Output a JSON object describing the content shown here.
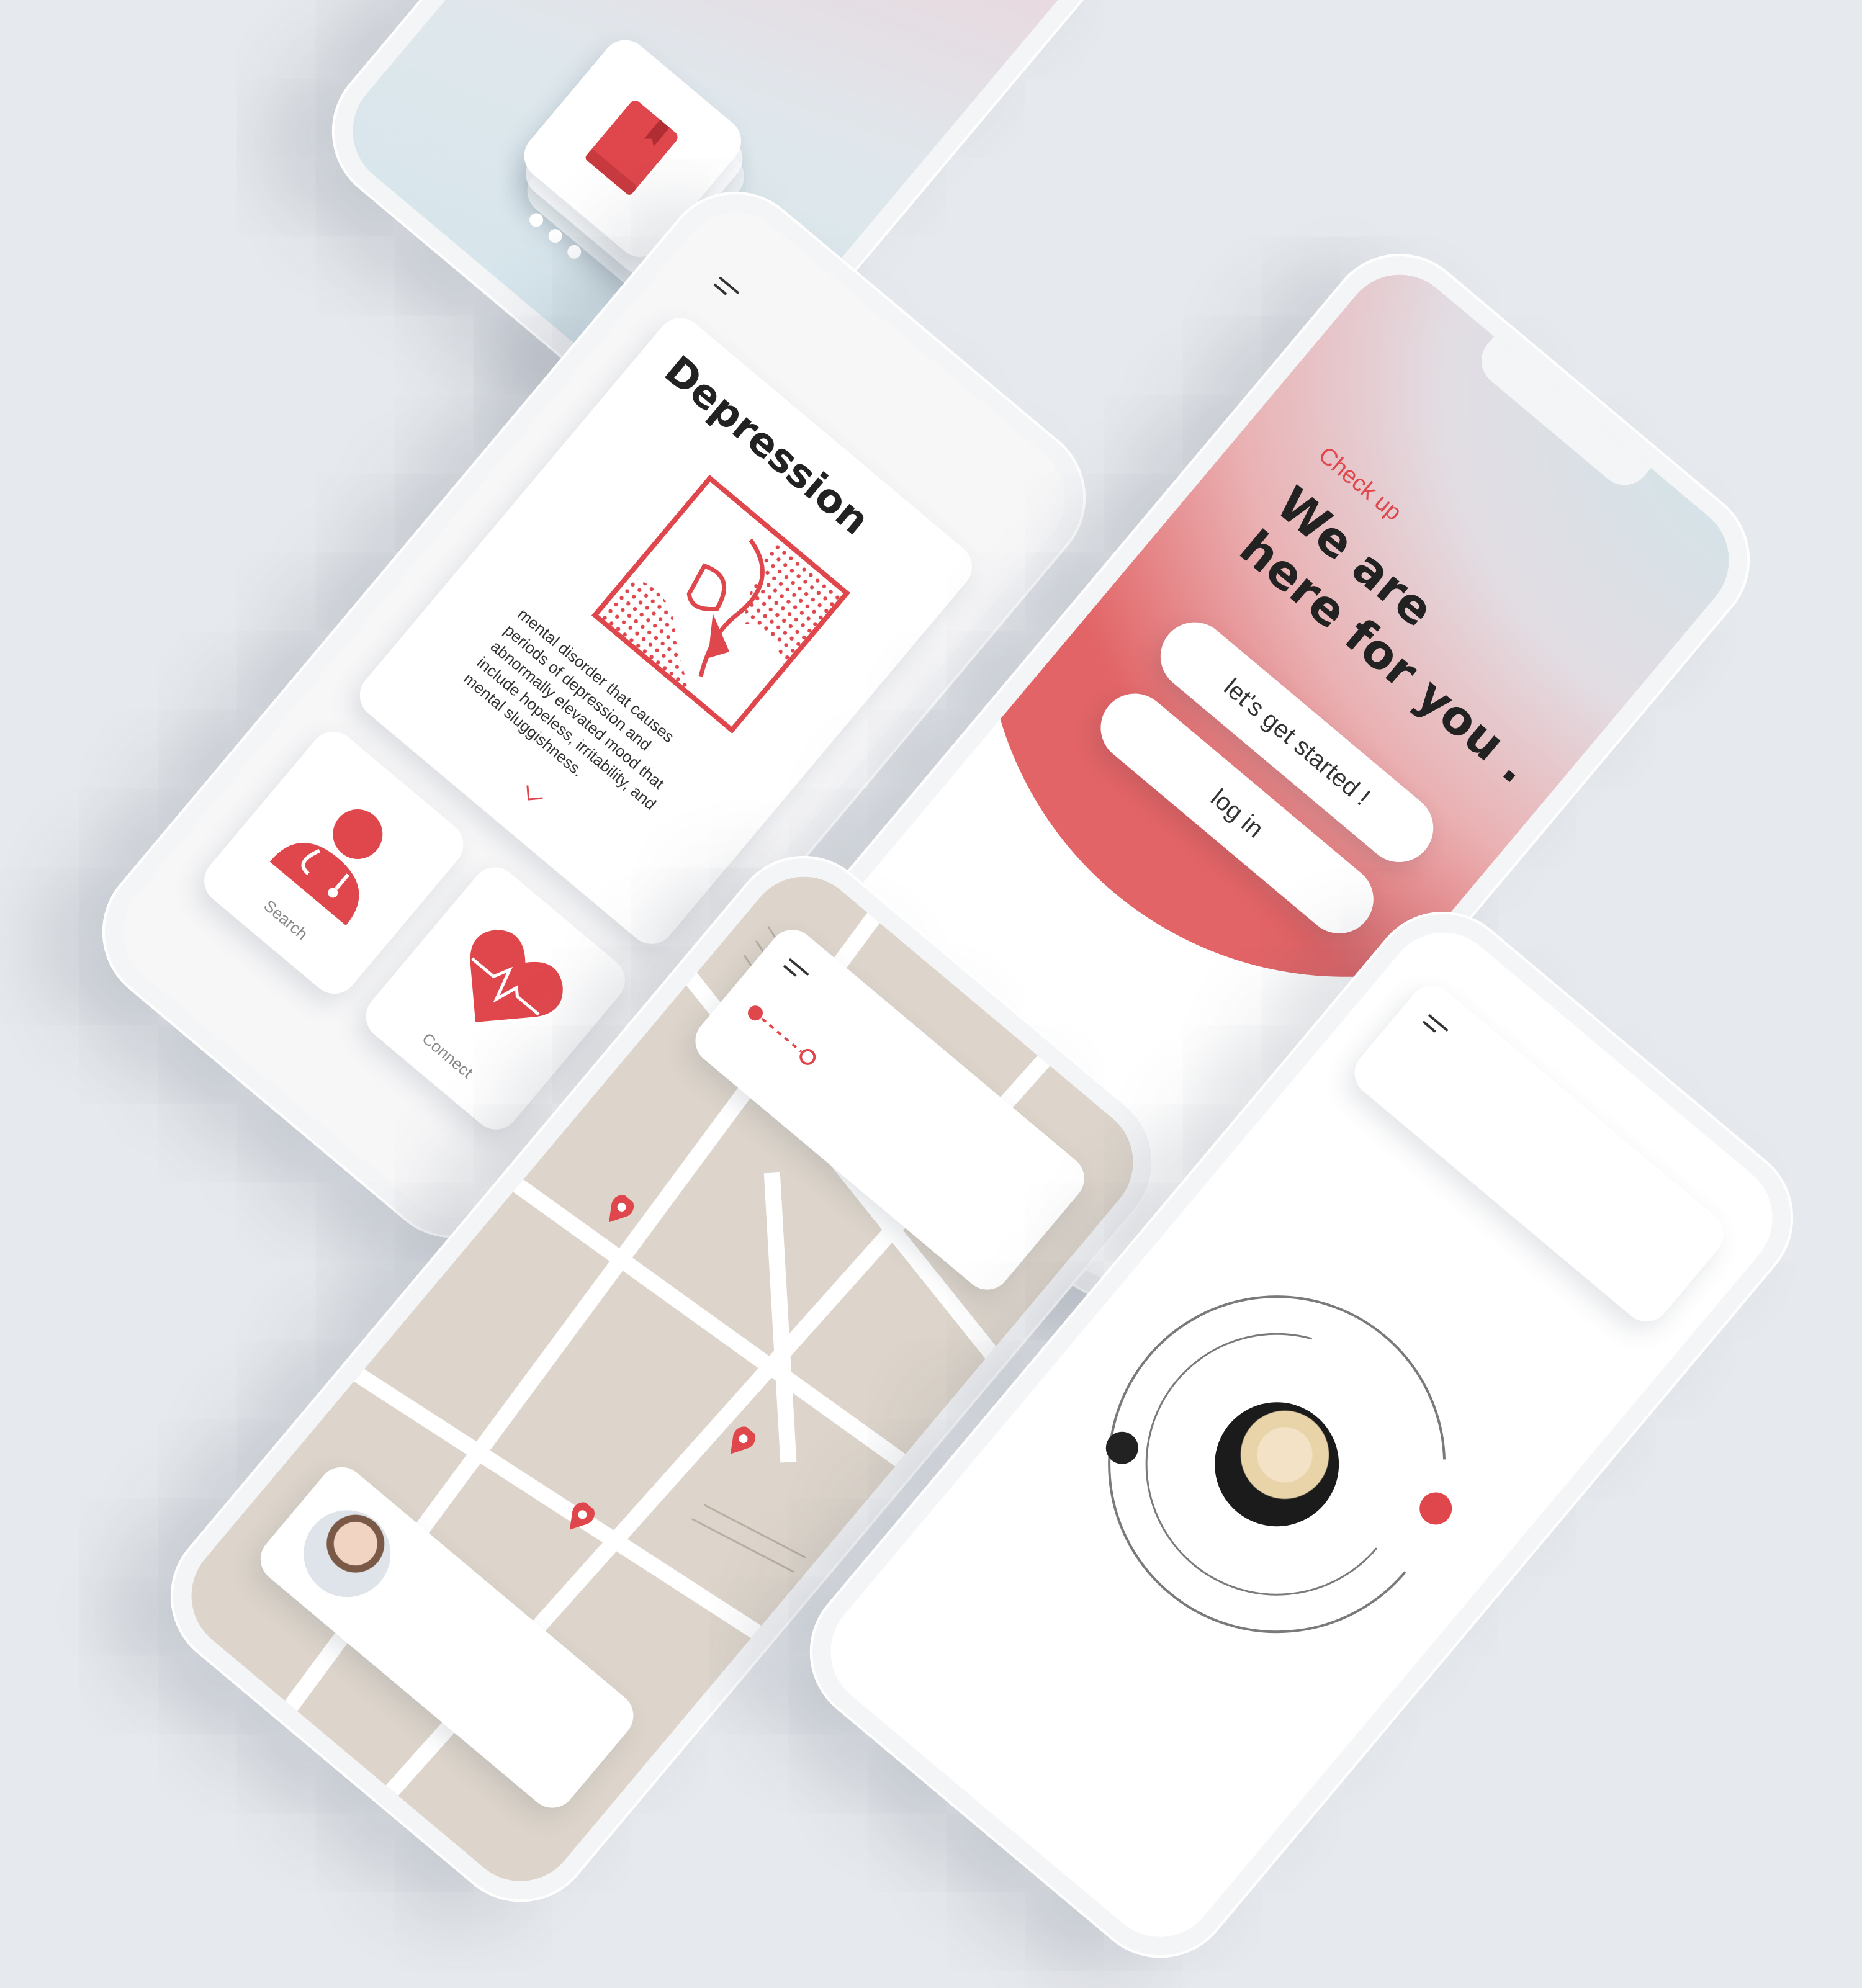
{
  "palette": {
    "background": "#e6e9ed",
    "accent": "#e0474c",
    "phone": "#f4f5f7",
    "map": "#ddd5cb"
  },
  "checkup_screen": {
    "brand": "Check up",
    "headline_line1": "We are",
    "headline_line2": "here for you .",
    "start_button": "let's get started !",
    "login_button": "log in"
  },
  "info_screen": {
    "menu_icon": "hamburger-icon",
    "card_title": "Depression",
    "card_text": "mental disorder that causes periods of depression and abnormally elevated mood that include hopeless, irritability, and mental sluggishness.",
    "expand_icon": "chevron-down-icon",
    "tiles": [
      {
        "label": "Search",
        "icon": "doctor-icon"
      },
      {
        "label": "Connect",
        "icon": "heartbeat-icon"
      }
    ]
  },
  "loading_screen": {
    "icon": "book-icon",
    "indicator": "ellipsis-icon"
  },
  "map_screen": {
    "menu_icon": "hamburger-icon",
    "icons": [
      "route-icon",
      "map-pin-icon",
      "doctor-avatar"
    ]
  },
  "profile_screen": {
    "menu_icon": "hamburger-icon",
    "icons": [
      "orbit-ring",
      "profile-avatar"
    ]
  }
}
